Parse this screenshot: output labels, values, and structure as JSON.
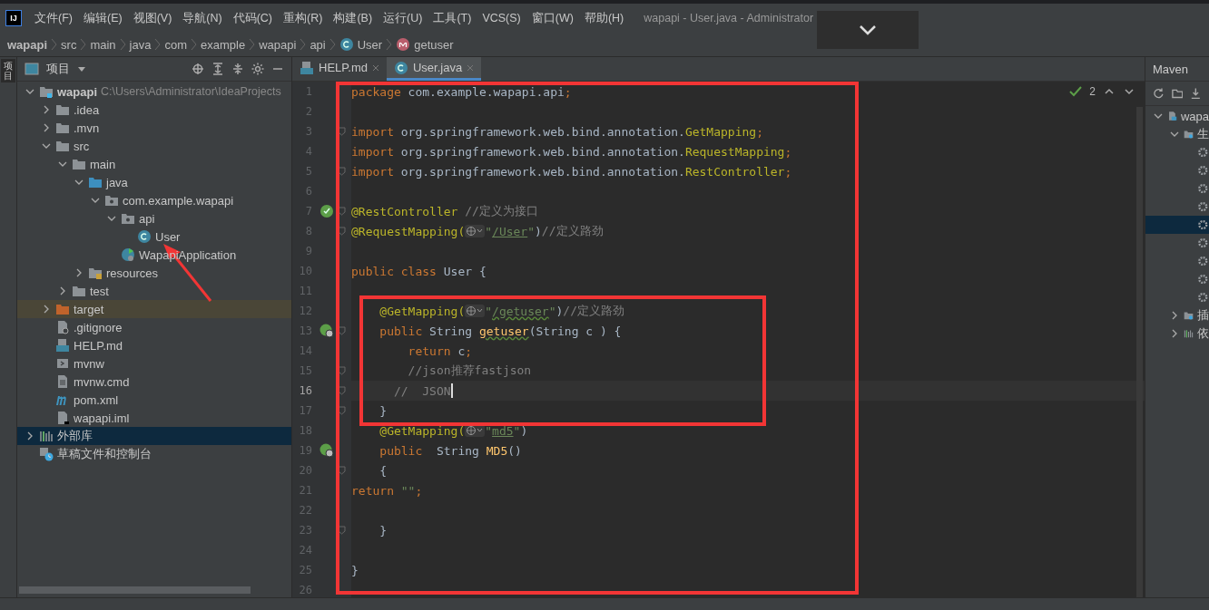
{
  "menu_bar": {
    "logo": "IJ",
    "items": [
      "文件(F)",
      "编辑(E)",
      "视图(V)",
      "导航(N)",
      "代码(C)",
      "重构(R)",
      "构建(B)",
      "运行(U)",
      "工具(T)",
      "VCS(S)",
      "窗口(W)",
      "帮助(H)"
    ],
    "title": "wapapi - User.java - Administrator"
  },
  "breadcrumbs": [
    {
      "label": "wapapi",
      "kind": "plain"
    },
    {
      "label": "src",
      "kind": "plain"
    },
    {
      "label": "main",
      "kind": "plain"
    },
    {
      "label": "java",
      "kind": "plain"
    },
    {
      "label": "com",
      "kind": "plain"
    },
    {
      "label": "example",
      "kind": "plain"
    },
    {
      "label": "wapapi",
      "kind": "plain"
    },
    {
      "label": "api",
      "kind": "plain"
    },
    {
      "label": "User",
      "kind": "class"
    },
    {
      "label": "getuser",
      "kind": "method"
    }
  ],
  "side_stripe": {
    "label": "项目"
  },
  "project_panel": {
    "title": "项目",
    "tree": [
      {
        "label": "wapapi",
        "kind": "module",
        "hint": "C:\\Users\\Administrator\\IdeaProjects",
        "expanded": true,
        "selected": false,
        "children": [
          {
            "label": ".idea",
            "kind": "folder",
            "expanded": false,
            "selected": false
          },
          {
            "label": ".mvn",
            "kind": "folder",
            "expanded": false,
            "selected": false
          },
          {
            "label": "src",
            "kind": "folder",
            "expanded": true,
            "selected": false,
            "children": [
              {
                "label": "main",
                "kind": "folder",
                "expanded": true,
                "selected": false,
                "children": [
                  {
                    "label": "java",
                    "kind": "source-folder",
                    "expanded": true,
                    "selected": false,
                    "children": [
                      {
                        "label": "com.example.wapapi",
                        "kind": "package",
                        "expanded": true,
                        "selected": false,
                        "children": [
                          {
                            "label": "api",
                            "kind": "package",
                            "expanded": true,
                            "selected": false,
                            "children": [
                              {
                                "label": "User",
                                "kind": "class",
                                "selected": false
                              }
                            ]
                          },
                          {
                            "label": "WapapiApplication",
                            "kind": "app-class",
                            "selected": false
                          }
                        ]
                      }
                    ]
                  },
                  {
                    "label": "resources",
                    "kind": "resources-folder",
                    "expanded": false,
                    "selected": false
                  }
                ]
              },
              {
                "label": "test",
                "kind": "folder",
                "expanded": false,
                "selected": false
              }
            ]
          },
          {
            "label": "target",
            "kind": "excluded-folder",
            "expanded": false,
            "selected": false
          },
          {
            "label": ".gitignore",
            "kind": "gitignore",
            "selected": false
          },
          {
            "label": "HELP.md",
            "kind": "markdown",
            "selected": false
          },
          {
            "label": "mvnw",
            "kind": "script",
            "selected": false
          },
          {
            "label": "mvnw.cmd",
            "kind": "text",
            "selected": false
          },
          {
            "label": "pom.xml",
            "kind": "maven",
            "selected": false
          },
          {
            "label": "wapapi.iml",
            "kind": "iml",
            "selected": false
          }
        ]
      },
      {
        "label": "外部库",
        "kind": "libraries",
        "expanded": false,
        "selected": true
      },
      {
        "label": "草稿文件和控制台",
        "kind": "scratches",
        "selected": false
      }
    ]
  },
  "tabs": [
    {
      "label": "HELP.md",
      "kind": "markdown",
      "selected": false
    },
    {
      "label": "User.java",
      "kind": "class",
      "selected": true
    }
  ],
  "inspection": {
    "count": "2"
  },
  "code_lines": [
    {
      "number": "1",
      "kind": "plain",
      "current": false,
      "fold": false,
      "tokens": [
        {
          "kind": "keyword",
          "text": "package"
        },
        {
          "kind": "plain",
          "text": " com.example.wapapi.api"
        },
        {
          "kind": "keyword",
          "text": ";"
        }
      ]
    },
    {
      "number": "2",
      "kind": "plain",
      "current": false,
      "fold": false
    },
    {
      "number": "3",
      "kind": "plain",
      "current": false,
      "fold": true,
      "tokens": [
        {
          "kind": "keyword",
          "text": "import"
        },
        {
          "kind": "plain",
          "text": " org.springframework.web.bind.annotation."
        },
        {
          "kind": "annotation",
          "text": "GetMapping"
        },
        {
          "kind": "keyword",
          "text": ";"
        }
      ]
    },
    {
      "number": "4",
      "kind": "plain",
      "current": false,
      "fold": false,
      "tokens": [
        {
          "kind": "keyword",
          "text": "import"
        },
        {
          "kind": "plain",
          "text": " org.springframework.web.bind.annotation."
        },
        {
          "kind": "annotation",
          "text": "RequestMapping"
        },
        {
          "kind": "keyword",
          "text": ";"
        }
      ]
    },
    {
      "number": "5",
      "kind": "plain",
      "current": false,
      "fold": true,
      "tokens": [
        {
          "kind": "keyword",
          "text": "import"
        },
        {
          "kind": "plain",
          "text": " org.springframework.web.bind.annotation."
        },
        {
          "kind": "annotation",
          "text": "RestController"
        },
        {
          "kind": "keyword",
          "text": ";"
        }
      ]
    },
    {
      "number": "6",
      "kind": "plain",
      "current": false,
      "fold": false
    },
    {
      "number": "7",
      "kind": "bean",
      "current": false,
      "fold": true,
      "tokens": [
        {
          "kind": "annotation",
          "text": "@RestController"
        },
        {
          "kind": "comment",
          "text": " //定义为接口"
        }
      ]
    },
    {
      "number": "8",
      "kind": "plain",
      "current": false,
      "fold": true,
      "tokens": [
        {
          "kind": "annotation",
          "text": "@RequestMapping("
        },
        {
          "kind": "hint"
        },
        {
          "kind": "string",
          "text": "\""
        },
        {
          "kind": "url",
          "text": "/User"
        },
        {
          "kind": "string",
          "text": "\""
        },
        {
          "kind": "plain",
          "text": ")"
        },
        {
          "kind": "comment",
          "text": "//定义路劲"
        }
      ]
    },
    {
      "number": "9",
      "kind": "plain",
      "current": false,
      "fold": false
    },
    {
      "number": "10",
      "kind": "plain",
      "current": false,
      "fold": false,
      "tokens": [
        {
          "kind": "keyword",
          "text": "public class"
        },
        {
          "kind": "plain",
          "text": " User {"
        }
      ]
    },
    {
      "number": "11",
      "kind": "plain",
      "current": false,
      "fold": false
    },
    {
      "number": "12",
      "kind": "plain",
      "current": false,
      "fold": false,
      "tokens": [
        {
          "kind": "annotation",
          "text": "    @GetMapping("
        },
        {
          "kind": "hint"
        },
        {
          "kind": "string",
          "text": "\""
        },
        {
          "kind": "url",
          "text": "/getuser",
          "warning": true
        },
        {
          "kind": "string",
          "text": "\""
        },
        {
          "kind": "plain",
          "text": ")"
        },
        {
          "kind": "comment",
          "text": "//定义路劲"
        }
      ]
    },
    {
      "number": "13",
      "kind": "endpoint",
      "current": false,
      "fold": true,
      "tokens": [
        {
          "kind": "keyword",
          "text": "    public"
        },
        {
          "kind": "plain",
          "text": " String "
        },
        {
          "kind": "method",
          "text": "getuser",
          "warning": true
        },
        {
          "kind": "plain",
          "text": "(String c ) {"
        }
      ]
    },
    {
      "number": "14",
      "kind": "plain",
      "current": false,
      "fold": false,
      "tokens": [
        {
          "kind": "keyword",
          "text": "        return"
        },
        {
          "kind": "plain",
          "text": " c"
        },
        {
          "kind": "keyword",
          "text": ";"
        }
      ]
    },
    {
      "number": "15",
      "kind": "plain",
      "current": false,
      "fold": true,
      "tokens": [
        {
          "kind": "comment",
          "text": "        //json推荐fastjson"
        }
      ]
    },
    {
      "number": "16",
      "kind": "plain",
      "current": true,
      "fold": true,
      "tokens": [
        {
          "kind": "comment",
          "text": "      //  JSON"
        }
      ]
    },
    {
      "number": "17",
      "kind": "plain",
      "current": false,
      "fold": true,
      "tokens": [
        {
          "kind": "plain",
          "text": "    }"
        }
      ]
    },
    {
      "number": "18",
      "kind": "plain",
      "current": false,
      "fold": false,
      "tokens": [
        {
          "kind": "annotation",
          "text": "    @GetMapping("
        },
        {
          "kind": "hint"
        },
        {
          "kind": "string",
          "text": "\""
        },
        {
          "kind": "url",
          "text": "md5",
          "warning": false
        },
        {
          "kind": "string",
          "text": "\""
        },
        {
          "kind": "plain",
          "text": ")"
        }
      ]
    },
    {
      "number": "19",
      "kind": "endpoint",
      "current": false,
      "fold": false,
      "tokens": [
        {
          "kind": "keyword",
          "text": "    public"
        },
        {
          "kind": "plain",
          "text": "  String "
        },
        {
          "kind": "method",
          "text": "MD5",
          "warning": false
        },
        {
          "kind": "plain",
          "text": "()"
        }
      ]
    },
    {
      "number": "20",
      "kind": "plain",
      "current": false,
      "fold": true,
      "tokens": [
        {
          "kind": "plain",
          "text": "    {"
        }
      ]
    },
    {
      "number": "21",
      "kind": "plain",
      "current": false,
      "fold": false,
      "tokens": [
        {
          "kind": "keyword",
          "text": "return"
        },
        {
          "kind": "string",
          "text": " \"\""
        },
        {
          "kind": "keyword",
          "text": ";"
        }
      ]
    },
    {
      "number": "22",
      "kind": "plain",
      "current": false,
      "fold": false
    },
    {
      "number": "23",
      "kind": "plain",
      "current": false,
      "fold": true,
      "tokens": [
        {
          "kind": "plain",
          "text": "    }"
        }
      ]
    },
    {
      "number": "24",
      "kind": "plain",
      "current": false,
      "fold": false
    },
    {
      "number": "25",
      "kind": "plain",
      "current": false,
      "fold": false,
      "tokens": [
        {
          "kind": "plain",
          "text": "}"
        }
      ]
    },
    {
      "number": "26",
      "kind": "plain",
      "current": false,
      "fold": false
    }
  ],
  "maven_panel": {
    "title": "Maven",
    "tree": [
      {
        "label": "wapa",
        "kind": "maven-module",
        "expanded": true,
        "selected": false,
        "children": [
          {
            "label": "生",
            "kind": "lifecycle",
            "expanded": true,
            "selected": false,
            "children": [
              {
                "kind": "goal",
                "selected": false
              },
              {
                "kind": "goal",
                "selected": false
              },
              {
                "kind": "goal",
                "selected": false
              },
              {
                "kind": "goal",
                "selected": false
              },
              {
                "kind": "goal",
                "selected": true
              },
              {
                "kind": "goal",
                "selected": false
              },
              {
                "kind": "goal",
                "selected": false
              },
              {
                "kind": "goal",
                "selected": false
              },
              {
                "kind": "goal",
                "selected": false
              }
            ]
          },
          {
            "label": "插",
            "kind": "lifecycle",
            "expanded": false,
            "selected": false
          },
          {
            "label": "依",
            "kind": "libraries",
            "expanded": false,
            "selected": false
          }
        ]
      }
    ]
  }
}
